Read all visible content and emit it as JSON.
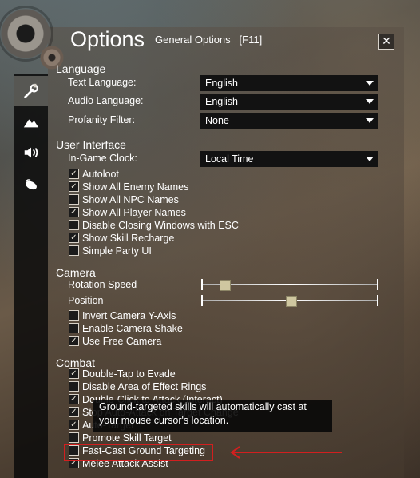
{
  "window": {
    "title": "Options",
    "subtitle": "General Options",
    "hotkey": "[F11]",
    "close_label": "✕"
  },
  "tabs": [
    {
      "icon": "wrench-icon",
      "active": true
    },
    {
      "icon": "mountain-icon",
      "active": false
    },
    {
      "icon": "speaker-icon",
      "active": false
    },
    {
      "icon": "mouse-icon",
      "active": false
    }
  ],
  "language": {
    "title": "Language",
    "text_language": {
      "label": "Text Language:",
      "value": "English"
    },
    "audio_language": {
      "label": "Audio Language:",
      "value": "English"
    },
    "profanity_filter": {
      "label": "Profanity Filter:",
      "value": "None"
    }
  },
  "ui": {
    "title": "User Interface",
    "clock": {
      "label": "In-Game Clock:",
      "value": "Local Time"
    },
    "checks": [
      {
        "label": "Autoloot",
        "checked": true
      },
      {
        "label": "Show All Enemy Names",
        "checked": true
      },
      {
        "label": "Show All NPC Names",
        "checked": false
      },
      {
        "label": "Show All Player Names",
        "checked": true
      },
      {
        "label": "Disable Closing Windows with ESC",
        "checked": false
      },
      {
        "label": "Show Skill Recharge",
        "checked": true
      },
      {
        "label": "Simple Party UI",
        "checked": false
      }
    ]
  },
  "camera": {
    "title": "Camera",
    "rotation_speed": {
      "label": "Rotation Speed",
      "value": 0.1
    },
    "position": {
      "label": "Position",
      "value": 0.5
    },
    "checks": [
      {
        "label": "Invert Camera Y-Axis",
        "checked": false
      },
      {
        "label": "Enable Camera Shake",
        "checked": false
      },
      {
        "label": "Use Free Camera",
        "checked": true
      }
    ]
  },
  "combat": {
    "title": "Combat",
    "checks": [
      {
        "label": "Double-Tap to Evade",
        "checked": true
      },
      {
        "label": "Disable Area of Effect Rings",
        "checked": false
      },
      {
        "label": "Double-Click to Attack (Interact)",
        "checked": true
      },
      {
        "label": "Stop Auto-Attack on Target Change",
        "checked": true
      },
      {
        "label": "Auto-Target",
        "checked": true
      },
      {
        "label": "Promote Skill Target",
        "checked": false
      },
      {
        "label": "Fast-Cast Ground Targeting",
        "checked": false
      },
      {
        "label": "Melee Attack Assist",
        "checked": true
      }
    ]
  },
  "tooltip": {
    "text": "Ground-targeted skills will automatically cast at your mouse cursor's location."
  },
  "colors": {
    "highlight": "#d21f1f",
    "accent": "#cfc7a0"
  }
}
